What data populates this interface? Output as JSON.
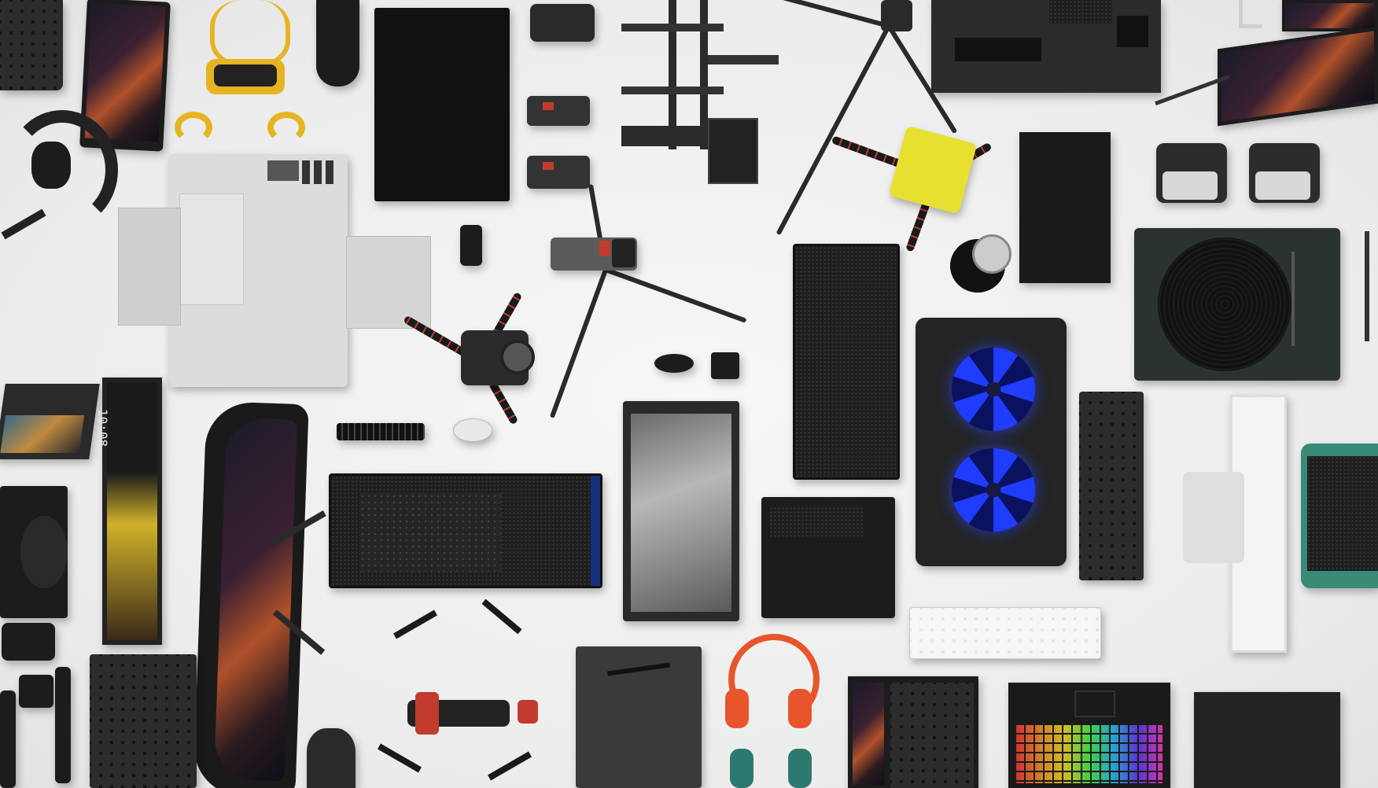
{
  "scene": {
    "description_colors": {
      "background": "#efefef",
      "device_dark": "#1c1c1c",
      "accent_red": "#c23b2e",
      "accent_yellow": "#e8e030",
      "fan_blue": "#1f3cff",
      "headphones_orange": "#e8552c"
    }
  },
  "monitor_clock": {
    "text": "10:08"
  }
}
